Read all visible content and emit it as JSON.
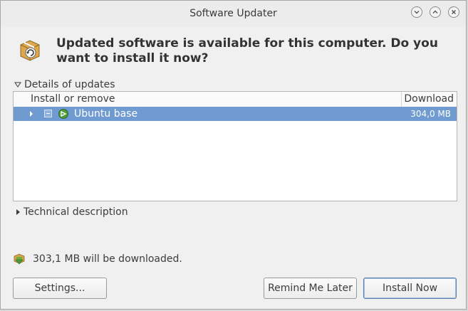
{
  "window": {
    "title": "Software Updater"
  },
  "window_controls": [
    {
      "name": "minimize-button",
      "icon": "chevron-down-icon"
    },
    {
      "name": "maximize-button",
      "icon": "chevron-up-icon"
    },
    {
      "name": "close-button",
      "icon": "close-icon"
    }
  ],
  "header": {
    "icon": "software-update-icon",
    "headline": "Updated software is available for this computer. Do you want to install it now?"
  },
  "details_expander": {
    "label": "Details of updates",
    "expanded": true
  },
  "update_list": {
    "columns": {
      "name": "Install or remove",
      "size": "Download"
    },
    "rows": [
      {
        "label": "Ubuntu base",
        "size": "304,0 MB",
        "selected": true,
        "checkbox_state": "mixed",
        "icon": "ubuntu-package-icon"
      }
    ]
  },
  "technical_expander": {
    "label": "Technical description",
    "expanded": false
  },
  "summary": {
    "icon": "download-package-icon",
    "text": "303,1 MB will be downloaded."
  },
  "buttons": {
    "settings": "Settings...",
    "remind": "Remind Me Later",
    "install": "Install Now"
  },
  "colors": {
    "selection": "#6f9bd1",
    "window_bg": "#f0f0f0"
  }
}
